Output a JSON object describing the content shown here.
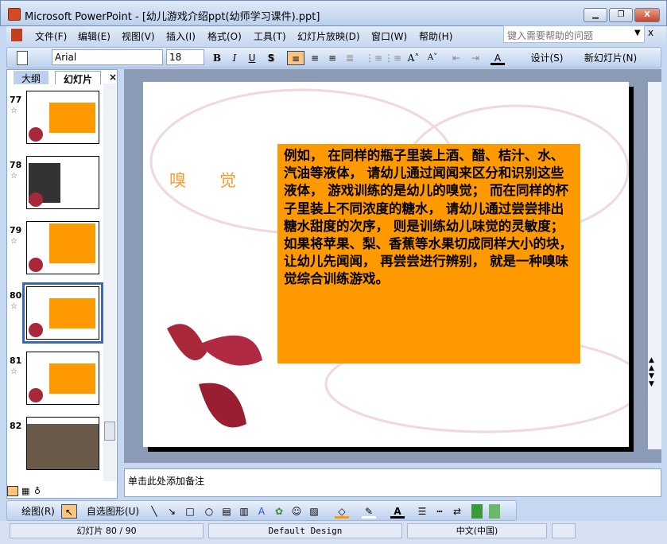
{
  "window": {
    "title": "Microsoft PowerPoint - [幼儿游戏介绍ppt(幼师学习课件).ppt]",
    "minimize": "▁",
    "restore": "❐",
    "close": "X"
  },
  "menu": [
    "文件(F)",
    "编辑(E)",
    "视图(V)",
    "插入(I)",
    "格式(O)",
    "工具(T)",
    "幻灯片放映(D)",
    "窗口(W)",
    "帮助(H)"
  ],
  "help": {
    "placeholder": "键入需要帮助的问题",
    "close": "x"
  },
  "toolbar": {
    "font": "Arial",
    "size": "18",
    "bold": "B",
    "italic": "I",
    "underline": "U",
    "shadow": "S",
    "font_color": "A",
    "design": "设计(S)",
    "new_slide": "新幻灯片(N)"
  },
  "panel": {
    "tabs": [
      "大纲",
      "幻灯片"
    ],
    "close": "×",
    "thumbs": [
      {
        "num": "77"
      },
      {
        "num": "78"
      },
      {
        "num": "79"
      },
      {
        "num": "80",
        "selected": true
      },
      {
        "num": "81"
      },
      {
        "num": "82"
      }
    ]
  },
  "slide": {
    "title": "嗅　　觉",
    "body": "例如， 在同样的瓶子里装上酒、醋、桔汁、水、汽油等液体， 请幼儿通过闻闻来区分和识别这些液体， 游戏训练的是幼儿的嗅觉； 而在同样的杯子里装上不同浓度的糖水， 请幼儿通过尝尝排出糖水甜度的次序， 则是训练幼儿味觉的灵敏度； 如果将苹果、梨、香蕉等水果切成同样大小的块， 让幼儿先闻闻， 再尝尝进行辨别， 就是一种嗅味觉综合训练游戏。",
    "box_color": "#ff9900",
    "title_color": "#ff9933"
  },
  "notes": {
    "placeholder": "单击此处添加备注"
  },
  "drawbar": {
    "draw": "绘图(R)",
    "autoshapes": "自选图形(U)"
  },
  "status": {
    "slide": "幻灯片 80 / 90",
    "design": "Default Design",
    "lang": "中文(中国)"
  }
}
